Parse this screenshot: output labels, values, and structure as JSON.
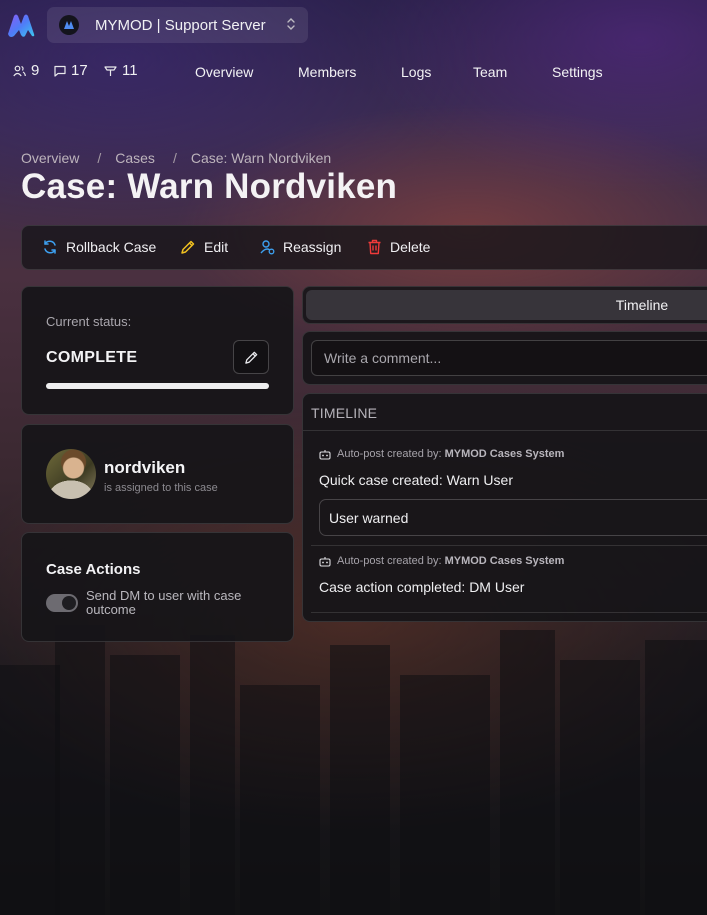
{
  "server": {
    "name": "MYMOD | Support Server"
  },
  "stats": {
    "members": "9",
    "messages": "17",
    "cases": "11"
  },
  "nav": {
    "items": [
      "Overview",
      "Members",
      "Logs",
      "Team",
      "Settings"
    ]
  },
  "breadcrumb": {
    "items": [
      "Overview",
      "Cases",
      "Case: Warn Nordviken"
    ],
    "separator": "/"
  },
  "page": {
    "title": "Case: Warn Nordviken"
  },
  "actions": {
    "rollback": "Rollback Case",
    "edit": "Edit",
    "reassign": "Reassign",
    "delete": "Delete"
  },
  "status": {
    "label": "Current status:",
    "value": "COMPLETE",
    "progress": 1.0
  },
  "assignee": {
    "name": "nordviken",
    "subtitle": "is assigned to this case"
  },
  "case_actions": {
    "title": "Case Actions",
    "dm_toggle_label": "Send DM to user with case outcome",
    "dm_toggle_on": true
  },
  "tabs": {
    "active": "Timeline"
  },
  "comment": {
    "placeholder": "Write a comment..."
  },
  "timeline": {
    "heading": "TIMELINE",
    "entries": [
      {
        "meta_prefix": "Auto-post created by:",
        "author": "MYMOD Cases System",
        "text": "Quick case created: Warn User",
        "box": "User warned"
      },
      {
        "meta_prefix": "Auto-post created by:",
        "author": "MYMOD Cases System",
        "text": "Case action completed: DM User"
      }
    ]
  },
  "colors": {
    "rollback_icon": "#3da0f0",
    "edit_icon": "#f0c020",
    "reassign_icon": "#3da0f0",
    "delete_icon": "#f03a3a"
  },
  "icons": [
    "app-logo-icon",
    "server-avatar-icon",
    "chevron-updown-icon",
    "users-icon",
    "message-icon",
    "cases-icon",
    "refresh-icon",
    "pencil-icon",
    "user-assign-icon",
    "trash-icon",
    "robot-icon"
  ]
}
